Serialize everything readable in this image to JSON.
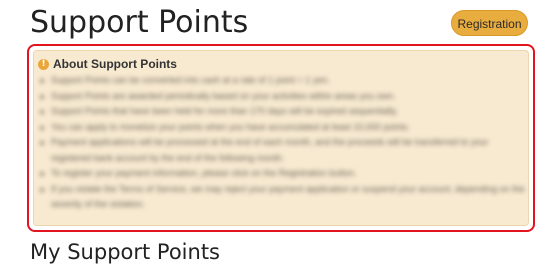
{
  "page_title": "Support Points",
  "registration_button": "Registration",
  "about": {
    "title": "About Support Points",
    "items": [
      {
        "text": "Support Points can be converted into cash at a rate of 1 point = 1 yen."
      },
      {
        "text": "Support Points are awarded periodically based on your activities within areas you own."
      },
      {
        "text": "Support Points that have been held for more than 170 days will be expired sequentially."
      },
      {
        "text": "You can apply to monetize your points when you have accumulated at least 10,000 points."
      },
      {
        "text": "Payment applications will be processed at the end of each month, and the proceeds will be transferred to your registered bank account by the end of the following month."
      },
      {
        "text": "To register your payment information, please click on the Registration button."
      },
      {
        "text": "If you violate the Terms of Service, we may reject your payment application or suspend your account, depending on the severity of the violation."
      }
    ]
  },
  "my_points_title": "My Support Points",
  "colors": {
    "accent": "#e9ac3e",
    "panel_bg": "#f8ead1",
    "highlight_border": "#e2141f"
  }
}
